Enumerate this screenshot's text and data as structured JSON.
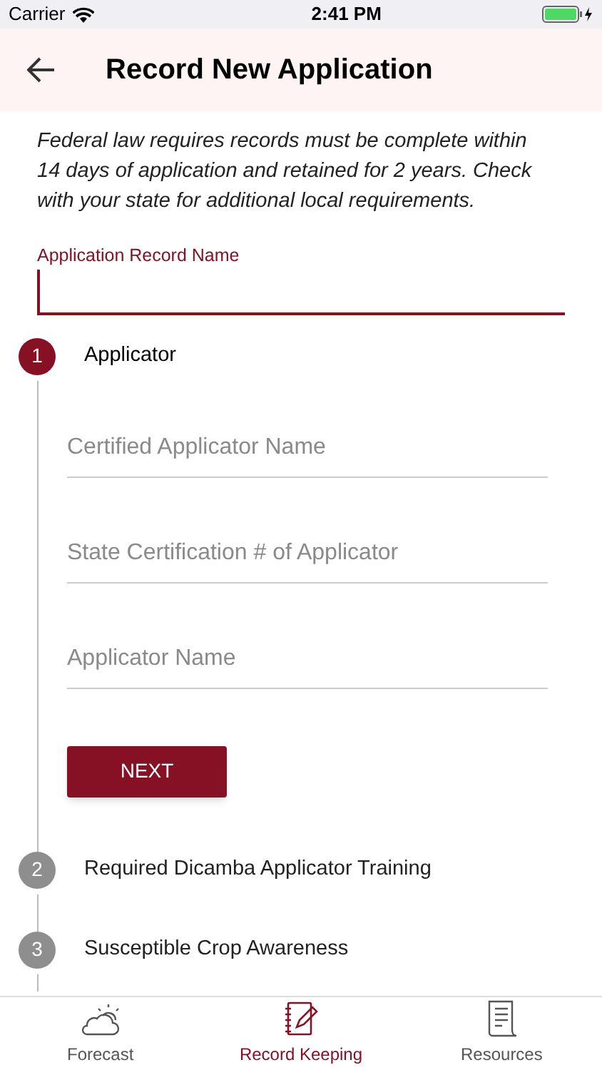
{
  "status_bar": {
    "carrier": "Carrier",
    "time": "2:41 PM"
  },
  "header": {
    "title": "Record New Application"
  },
  "notice": "Federal law requires records must be complete within 14 days of application and retained for 2 years. Check with your state for additional local requirements.",
  "record_name": {
    "label": "Application Record Name"
  },
  "steps": [
    {
      "number": "1",
      "title": "Applicator",
      "selected": true,
      "fields": [
        {
          "placeholder": "Certified Applicator Name"
        },
        {
          "placeholder": "State Certification # of Applicator"
        },
        {
          "placeholder": "Applicator Name"
        }
      ],
      "button": "NEXT"
    },
    {
      "number": "2",
      "title": "Required Dicamba Applicator Training",
      "selected": false
    },
    {
      "number": "3",
      "title": "Susceptible Crop Awareness",
      "selected": false
    }
  ],
  "tabs": [
    {
      "label": "Forecast",
      "kind": "forecast",
      "selected": false
    },
    {
      "label": "Record Keeping",
      "kind": "records",
      "selected": true
    },
    {
      "label": "Resources",
      "kind": "resources",
      "selected": false
    }
  ]
}
